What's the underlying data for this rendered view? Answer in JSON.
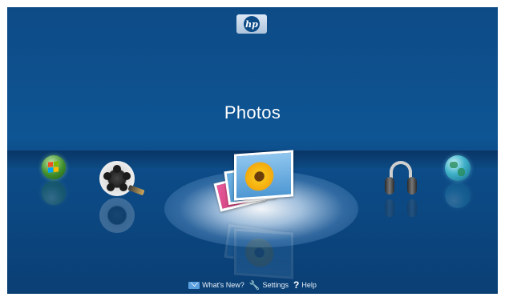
{
  "header": {
    "logo_text": "hp"
  },
  "main": {
    "title": "Photos",
    "apps": [
      {
        "name": "windows",
        "icon": "windows-orb-icon"
      },
      {
        "name": "videos",
        "icon": "film-reel-icon"
      },
      {
        "name": "photos",
        "icon": "photo-stack-icon",
        "selected": true
      },
      {
        "name": "music",
        "icon": "headphones-icon"
      },
      {
        "name": "internet",
        "icon": "globe-icon"
      }
    ]
  },
  "footer": {
    "whats_new": "What's New?",
    "settings": "Settings",
    "help": "Help"
  },
  "colors": {
    "background": "#0e5594",
    "horizon": "#0a3566",
    "text": "#ffffff"
  }
}
